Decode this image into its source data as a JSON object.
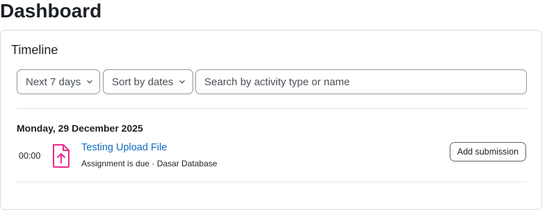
{
  "page": {
    "title": "Dashboard"
  },
  "timeline": {
    "title": "Timeline",
    "filter_label": "Next 7 days",
    "sort_label": "Sort by dates",
    "search_placeholder": "Search by activity type or name",
    "groups": [
      {
        "date": "Monday, 29 December 2025",
        "events": [
          {
            "time": "00:00",
            "icon": "file-upload-icon",
            "name": "Testing Upload File",
            "meta": "Assignment is due · Dasar Database",
            "action_label": "Add submission"
          }
        ]
      }
    ]
  },
  "colors": {
    "link": "#0f6cbf",
    "icon_accent": "#e8288a"
  }
}
